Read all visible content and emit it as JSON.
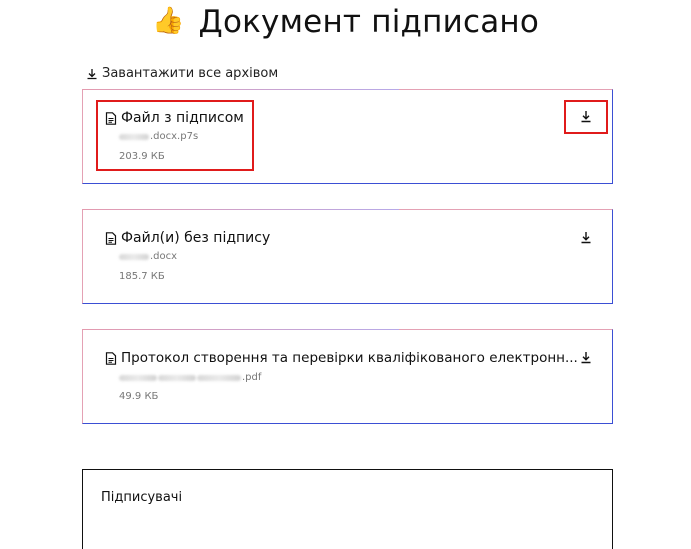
{
  "header": {
    "icon": "thumbs-up-emoji",
    "thumb_glyph": "👍",
    "title": "Документ підписано"
  },
  "download_all": {
    "icon": "download-icon",
    "label": "Завантажити все архівом"
  },
  "files": [
    {
      "icon": "document-icon",
      "title": "Файл з підписом",
      "file_name_suffix": ".docx.p7s",
      "file_name_obscured": true,
      "size": "203.9 КБ",
      "download_icon": "download-icon",
      "highlighted": true
    },
    {
      "icon": "document-icon",
      "title": "Файл(и) без підпису",
      "file_name_suffix": ".docx",
      "file_name_obscured": true,
      "size": "185.7 КБ",
      "download_icon": "download-icon",
      "highlighted": false
    },
    {
      "icon": "document-icon",
      "title": "Протокол створення та перевірки кваліфікованого електронн...",
      "file_name_suffix": ".pdf",
      "file_name_obscured": true,
      "size": "49.9 КБ",
      "download_icon": "download-icon",
      "highlighted": false
    }
  ],
  "signers": {
    "label": "Підписувачі"
  },
  "colors": {
    "highlight": "#e01b1b",
    "card_border_blue": "#3b4fd4",
    "card_border_pink": "#e4a1b4"
  }
}
